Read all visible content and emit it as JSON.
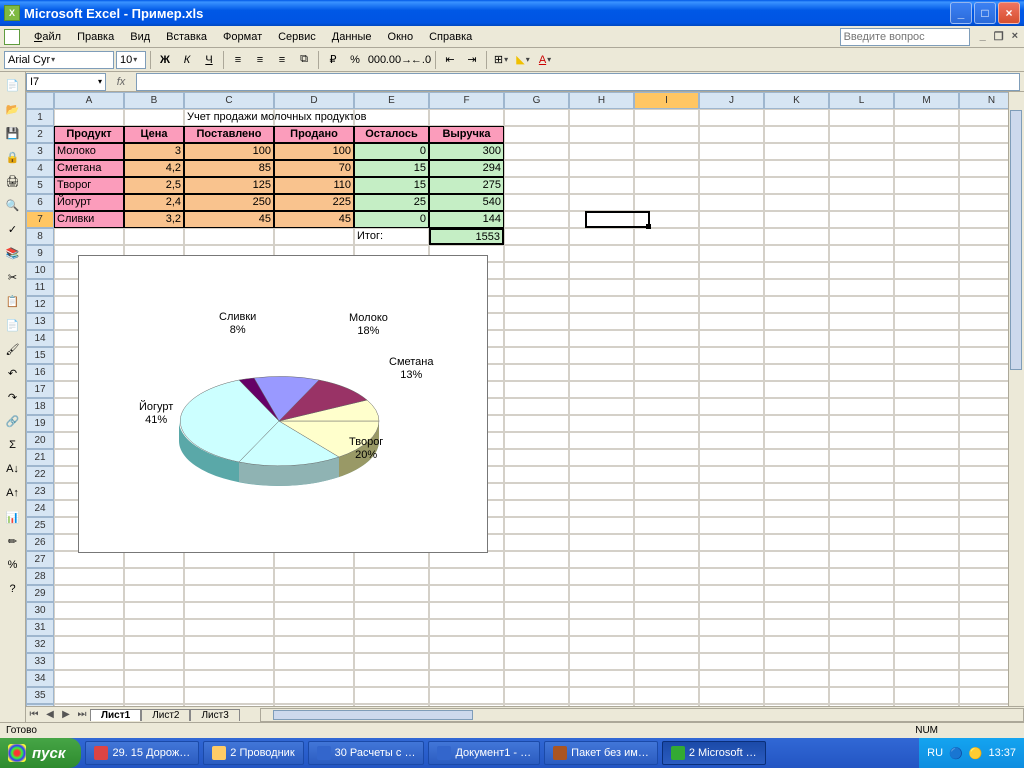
{
  "window": {
    "title": "Microsoft Excel - Пример.xls"
  },
  "menu": {
    "file": "Файл",
    "edit": "Правка",
    "view": "Вид",
    "insert": "Вставка",
    "format": "Формат",
    "tools": "Сервис",
    "data": "Данные",
    "window": "Окно",
    "help": "Справка",
    "help_placeholder": "Введите вопрос"
  },
  "format_toolbar": {
    "font_name": "Arial Cyr",
    "font_size": "10"
  },
  "formula_bar": {
    "name_box": "I7",
    "formula": ""
  },
  "columns": [
    "A",
    "B",
    "C",
    "D",
    "E",
    "F",
    "G",
    "H",
    "I",
    "J",
    "K",
    "L",
    "M",
    "N"
  ],
  "rows_count": 38,
  "active_col": "I",
  "active_row": 7,
  "sheet": {
    "title_row": "Учет продажи молочных продуктов",
    "headers": [
      "Продукт",
      "Цена",
      "Поставлено",
      "Продано",
      "Осталось",
      "Выручка"
    ],
    "rows": [
      {
        "name": "Молоко",
        "price": "3",
        "supplied": "100",
        "sold": "100",
        "left": "0",
        "rev": "300"
      },
      {
        "name": "Сметана",
        "price": "4,2",
        "supplied": "85",
        "sold": "70",
        "left": "15",
        "rev": "294"
      },
      {
        "name": "Творог",
        "price": "2,5",
        "supplied": "125",
        "sold": "110",
        "left": "15",
        "rev": "275"
      },
      {
        "name": "Йогурт",
        "price": "2,4",
        "supplied": "250",
        "sold": "225",
        "left": "25",
        "rev": "540"
      },
      {
        "name": "Сливки",
        "price": "3,2",
        "supplied": "45",
        "sold": "45",
        "left": "0",
        "rev": "144"
      }
    ],
    "total_label": "Итог:",
    "total_value": "1553"
  },
  "chart_data": {
    "type": "pie",
    "categories": [
      "Молоко",
      "Сметана",
      "Творог",
      "Йогурт",
      "Сливки"
    ],
    "values": [
      18,
      13,
      20,
      41,
      8
    ],
    "labels": {
      "moloko": "Молоко\n18%",
      "smetana": "Сметана\n13%",
      "tvorog": "Творог\n20%",
      "yogurt": "Йогурт\n41%",
      "slivki": "Сливки\n8%"
    },
    "colors": [
      "#9999ff",
      "#993366",
      "#ffffcc",
      "#ccffff",
      "#660066"
    ]
  },
  "tabs": {
    "sheet1": "Лист1",
    "sheet2": "Лист2",
    "sheet3": "Лист3"
  },
  "status": {
    "ready": "Готово",
    "num": "NUM"
  },
  "taskbar": {
    "start": "пуск",
    "items": [
      "29. 15 Дорож…",
      "2 Проводник",
      "30 Расчеты с …",
      "Документ1 - …",
      "Пакет без им…",
      "2 Microsoft …"
    ],
    "lang": "RU",
    "time": "13:37"
  }
}
